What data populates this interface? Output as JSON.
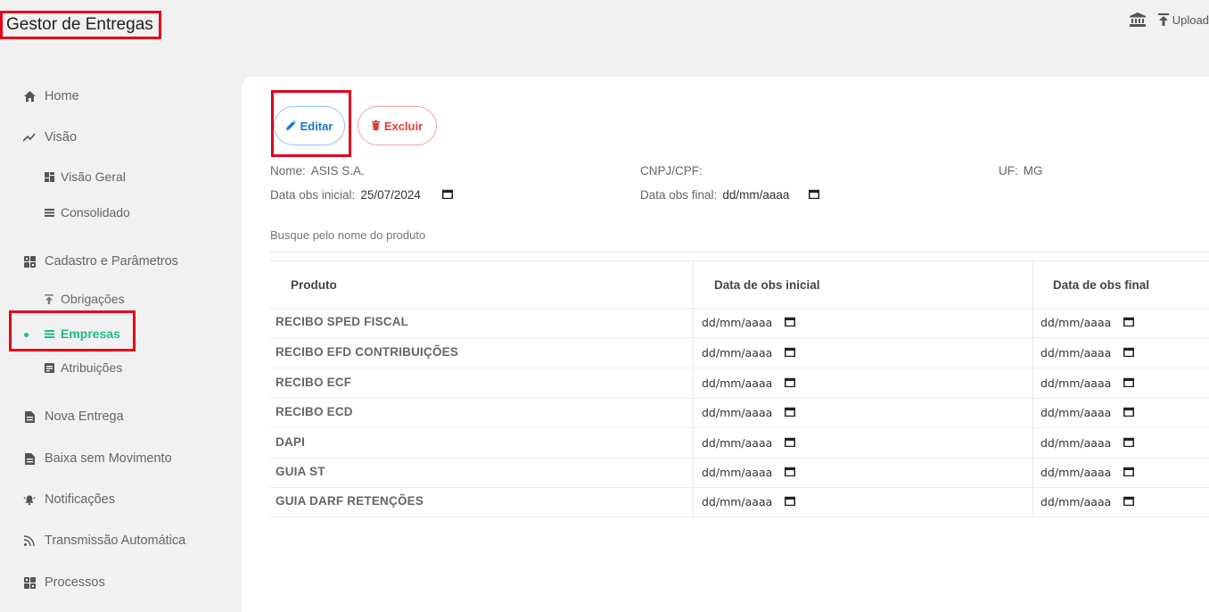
{
  "app": {
    "title": "Gestor de Entregas"
  },
  "topbar": {
    "upload_label": "Upload"
  },
  "sidebar": {
    "home": "Home",
    "visao": "Visão",
    "visao_geral": "Visão Geral",
    "consolidado": "Consolidado",
    "cadastro": "Cadastro e Parâmetros",
    "obrigacoes": "Obrigações",
    "empresas": "Empresas",
    "atribuicoes": "Atribuições",
    "nova_entrega": "Nova Entrega",
    "baixa": "Baixa sem Movimento",
    "notificacoes": "Notificações",
    "transmissao": "Transmissão Automática",
    "processos": "Processos"
  },
  "actions": {
    "edit_label": "Editar",
    "delete_label": "Excluir"
  },
  "company": {
    "name_label": "Nome:",
    "name": "ASIS S.A.",
    "cnpj_label": "CNPJ/CPF:",
    "cnpj": "",
    "uf_label": "UF:",
    "uf": "MG",
    "obs_initial_label": "Data obs inicial:",
    "obs_initial": "25/07/2024",
    "obs_final_label": "Data obs final:",
    "obs_final": "dd/mm/aaaa"
  },
  "search": {
    "placeholder": "Busque pelo nome do produto"
  },
  "table": {
    "headers": [
      "Produto",
      "Data de obs inicial",
      "Data de obs final"
    ],
    "rows": [
      {
        "product": "RECIBO SPED FISCAL",
        "initial": "dd/mm/aaaa",
        "final": "dd/mm/aaaa"
      },
      {
        "product": "RECIBO EFD CONTRIBUIÇÕES",
        "initial": "dd/mm/aaaa",
        "final": "dd/mm/aaaa"
      },
      {
        "product": "RECIBO ECF",
        "initial": "dd/mm/aaaa",
        "final": "dd/mm/aaaa"
      },
      {
        "product": "RECIBO ECD",
        "initial": "dd/mm/aaaa",
        "final": "dd/mm/aaaa"
      },
      {
        "product": "DAPI",
        "initial": "dd/mm/aaaa",
        "final": "dd/mm/aaaa"
      },
      {
        "product": "GUIA ST",
        "initial": "dd/mm/aaaa",
        "final": "dd/mm/aaaa"
      },
      {
        "product": "GUIA DARF RETENÇÕES",
        "initial": "dd/mm/aaaa",
        "final": "dd/mm/aaaa"
      }
    ]
  },
  "colors": {
    "accent": "#1cc07d",
    "highlight": "#e3001b",
    "edit": "#1976d2",
    "delete": "#e53935"
  }
}
